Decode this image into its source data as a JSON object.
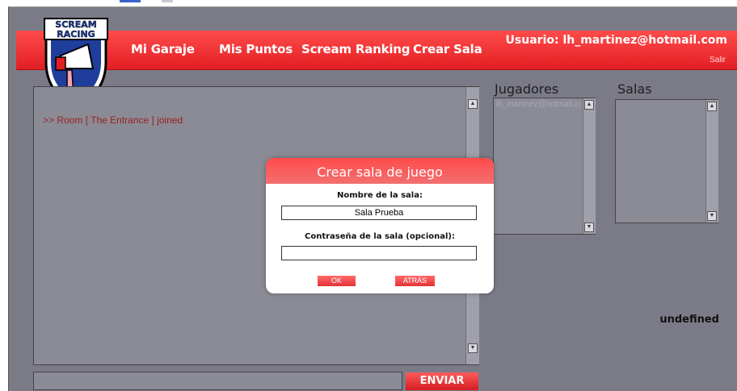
{
  "nav": {
    "items": [
      "Mi Garaje",
      "Mis Puntos",
      "Scream Ranking",
      "Crear Sala"
    ],
    "user_label": "Usuario: lh_martinez@hotmail.com",
    "logout": "Salir"
  },
  "logo": {
    "line1": "SCREAM",
    "line2": "RACING"
  },
  "chat": {
    "messages": [
      ">> Room [ The Entrance ] joined"
    ],
    "send_label": "ENVIAR",
    "input_value": ""
  },
  "players": {
    "title": "Jugadores",
    "items": [
      "lh_martinez@hotmail.com"
    ]
  },
  "rooms": {
    "title": "Salas",
    "items": []
  },
  "status_text": "undefined",
  "modal": {
    "title": "Crear sala de juego",
    "name_label": "Nombre de la sala:",
    "name_value": "Sala Prueba",
    "password_label": "Contraseña de la sala (opcional):",
    "password_value": "",
    "ok_label": "OK",
    "back_label": "ATRÁS"
  },
  "colors": {
    "brand_red": "#e21f23",
    "background_gray": "#7b7b88",
    "panel_gray": "#8b8b96"
  }
}
